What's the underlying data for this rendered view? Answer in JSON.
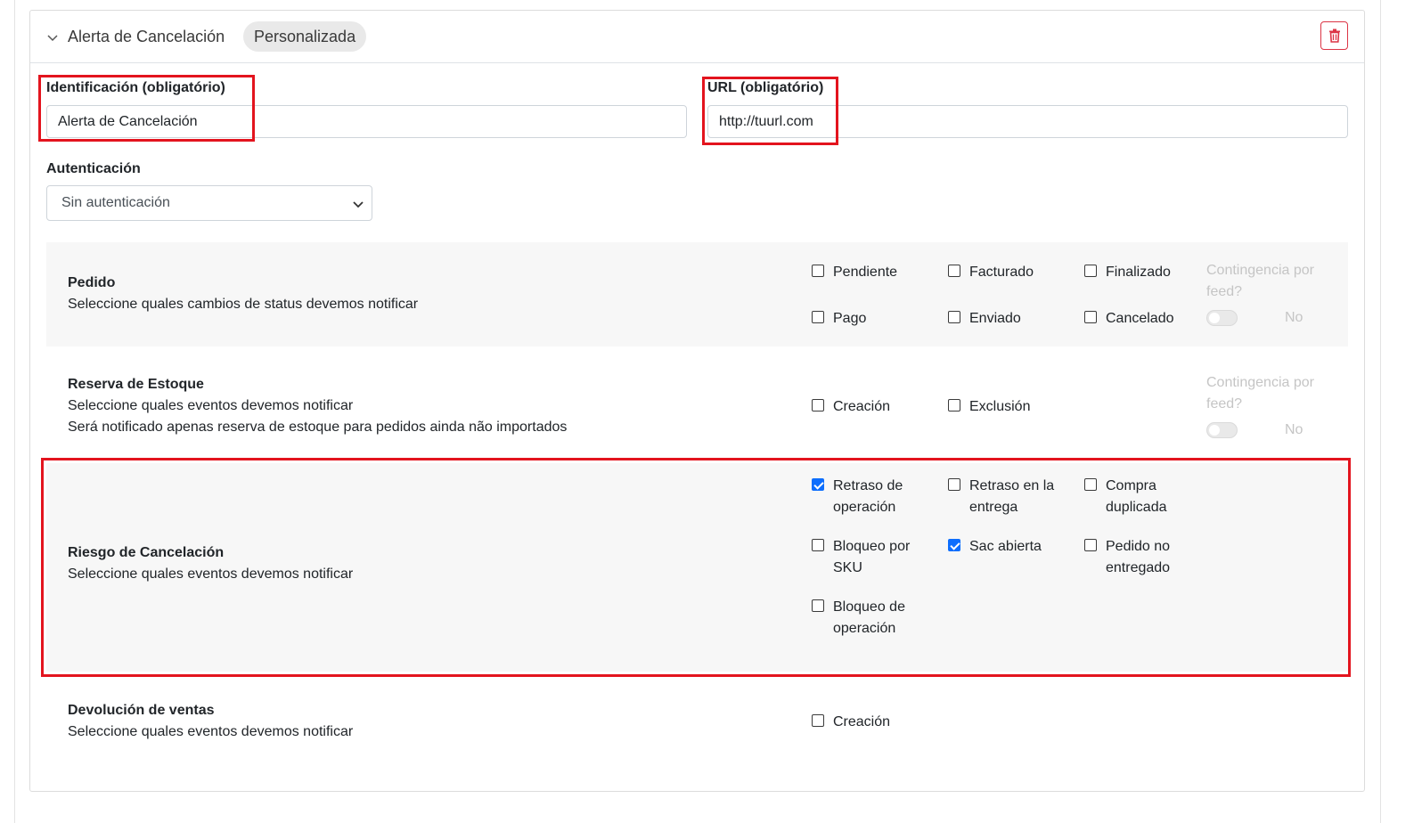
{
  "header": {
    "title": "Alerta de Cancelación",
    "badge": "Personalizada"
  },
  "form": {
    "identification": {
      "label": "Identificación (obligatório)",
      "value": "Alerta de Cancelación"
    },
    "url": {
      "label": "URL (obligatório)",
      "value": "http://tuurl.com"
    },
    "auth": {
      "label": "Autenticación",
      "selected": "Sin autenticación"
    }
  },
  "sections": {
    "pedido": {
      "title": "Pedido",
      "desc": "Seleccione quales cambios de status devemos notificar",
      "options": [
        {
          "label": "Pendiente",
          "checked": false
        },
        {
          "label": "Facturado",
          "checked": false
        },
        {
          "label": "Finalizado",
          "checked": false
        },
        {
          "label": "Pago",
          "checked": false
        },
        {
          "label": "Enviado",
          "checked": false
        },
        {
          "label": "Cancelado",
          "checked": false
        }
      ],
      "contingency_line1": "Contingencia por",
      "contingency_line2": "feed?",
      "contingency_value": "No"
    },
    "reserva": {
      "title": "Reserva de Estoque",
      "desc1": "Seleccione quales eventos devemos notificar",
      "desc2": "Será notificado apenas reserva de estoque para pedidos ainda não importados",
      "options": [
        {
          "label": "Creación",
          "checked": false
        },
        {
          "label": "Exclusión",
          "checked": false
        }
      ],
      "contingency_line1": "Contingencia por",
      "contingency_line2": "feed?",
      "contingency_value": "No"
    },
    "riesgo": {
      "title": "Riesgo de Cancelación",
      "desc": "Seleccione quales eventos devemos notificar",
      "options": [
        {
          "line1": "Retraso de",
          "line2": "operación",
          "checked": true
        },
        {
          "line1": "Retraso en la",
          "line2": "entrega",
          "checked": false
        },
        {
          "line1": "Compra",
          "line2": "duplicada",
          "checked": false
        },
        {
          "line1": "Bloqueo por",
          "line2": "SKU",
          "checked": false
        },
        {
          "line1": "Sac abierta",
          "line2": "",
          "checked": true
        },
        {
          "line1": "Pedido no",
          "line2": "entregado",
          "checked": false
        },
        {
          "line1": "Bloqueo de",
          "line2": "operación",
          "checked": false
        }
      ]
    },
    "devolucion": {
      "title": "Devolución de ventas",
      "desc": "Seleccione quales eventos devemos notificar",
      "options": [
        {
          "label": "Creación",
          "checked": false
        }
      ]
    }
  },
  "colors": {
    "highlight": "#e3141e",
    "checkbox_checked": "#0d6efd",
    "danger": "#dc3545"
  },
  "icons": {
    "collapse": "chevron-down-icon",
    "delete": "trash-icon",
    "select_caret": "chevron-down-icon"
  }
}
